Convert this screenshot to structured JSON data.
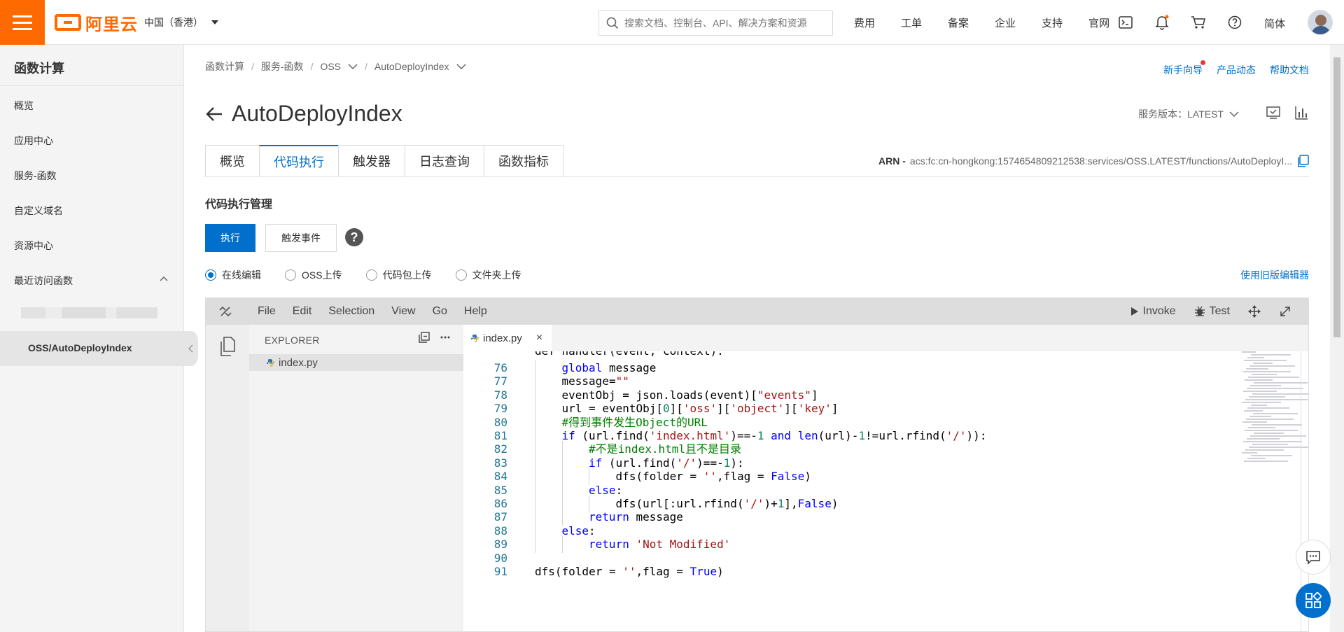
{
  "topbar": {
    "logo_text": "阿里云",
    "region": "中国（香港）",
    "search_placeholder": "搜索文档、控制台、API、解决方案和资源",
    "nav": [
      "费用",
      "工单",
      "备案",
      "企业",
      "支持",
      "官网"
    ],
    "lang": "简体",
    "icons": [
      "terminal-icon",
      "bell-icon",
      "cart-icon",
      "help-icon"
    ],
    "brand_color": "#ff6a00"
  },
  "sidebar": {
    "title": "函数计算",
    "items": [
      "概览",
      "应用中心",
      "服务-函数",
      "自定义域名",
      "资源中心"
    ],
    "recent_label": "最近访问函数",
    "active_item": "OSS/AutoDeployIndex"
  },
  "breadcrumb": {
    "items": [
      "函数计算",
      "服务-函数",
      "OSS",
      "AutoDeployIndex"
    ]
  },
  "helpers": [
    "新手向导",
    "产品动态",
    "帮助文档"
  ],
  "page": {
    "title": "AutoDeployIndex",
    "version_label": "服务版本：LATEST"
  },
  "tabs": [
    "概览",
    "代码执行",
    "触发器",
    "日志查询",
    "函数指标"
  ],
  "active_tab": "代码执行",
  "arn": {
    "label": "ARN -",
    "value": "acs:fc:cn-hongkong:1574654809212538:services/OSS.LATEST/functions/AutoDeployI..."
  },
  "code_section": {
    "title": "代码执行管理",
    "run_button": "执行",
    "trigger_button": "触发事件",
    "help": "?",
    "radios": [
      "在线编辑",
      "OSS上传",
      "代码包上传",
      "文件夹上传"
    ],
    "selected_radio": "在线编辑",
    "old_editor_link": "使用旧版编辑器"
  },
  "ide": {
    "menu": [
      "File",
      "Edit",
      "Selection",
      "View",
      "Go",
      "Help"
    ],
    "invoke": "Invoke",
    "test": "Test",
    "explorer_title": "EXPLORER",
    "file": "index.py",
    "tab": "index.py",
    "partial_line": "def handler(event, context):",
    "lines": [
      {
        "n": "76",
        "code": "global message"
      },
      {
        "n": "77",
        "code": "message=\"\""
      },
      {
        "n": "78",
        "code": "eventObj = json.loads(event)[\"events\"]"
      },
      {
        "n": "79",
        "code": "url = eventObj[0]['oss']['object']['key']"
      },
      {
        "n": "80",
        "code": "#得到事件发生Object的URL"
      },
      {
        "n": "81",
        "code": "if (url.find('index.html')==-1 and len(url)-1!=url.rfind('/')):"
      },
      {
        "n": "82",
        "code": "#不是index.html且不是目录"
      },
      {
        "n": "83",
        "code": "if (url.find('/')==-1):"
      },
      {
        "n": "84",
        "code": "dfs(folder = '',flag = False)"
      },
      {
        "n": "85",
        "code": "else:"
      },
      {
        "n": "86",
        "code": "dfs(url[:url.rfind('/')+1],False)"
      },
      {
        "n": "87",
        "code": "return message"
      },
      {
        "n": "88",
        "code": "else:"
      },
      {
        "n": "89",
        "code": "return 'Not Modified'"
      },
      {
        "n": "90",
        "code": ""
      },
      {
        "n": "91",
        "code": "dfs(folder = '',flag = True)"
      }
    ]
  }
}
